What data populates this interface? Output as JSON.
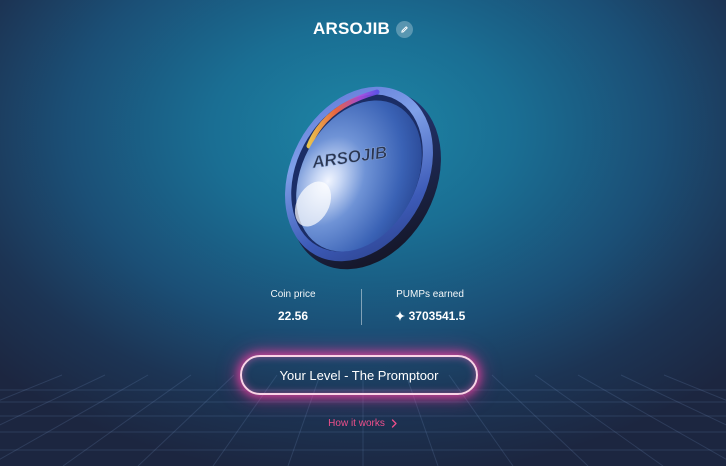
{
  "header": {
    "coin_name": "ARSOJIB",
    "edit_icon": "pencil-icon"
  },
  "coin": {
    "engraving": "ARSOJIB"
  },
  "stats": {
    "coin_price_label": "Coin price",
    "coin_price_value": "22.56",
    "pumps_label": "PUMPs earned",
    "pumps_icon": "sparkle-icon",
    "pumps_value": "3703541.5"
  },
  "level_button": {
    "label": "Your Level - The Promptoor"
  },
  "how_it_works": {
    "label": "How it works",
    "icon": "chevron-right-icon"
  },
  "colors": {
    "accent_pink": "#ee4f8b",
    "button_glow": "#ff46aa",
    "background_center": "#1d86a6",
    "background_edge": "#1c2640"
  }
}
